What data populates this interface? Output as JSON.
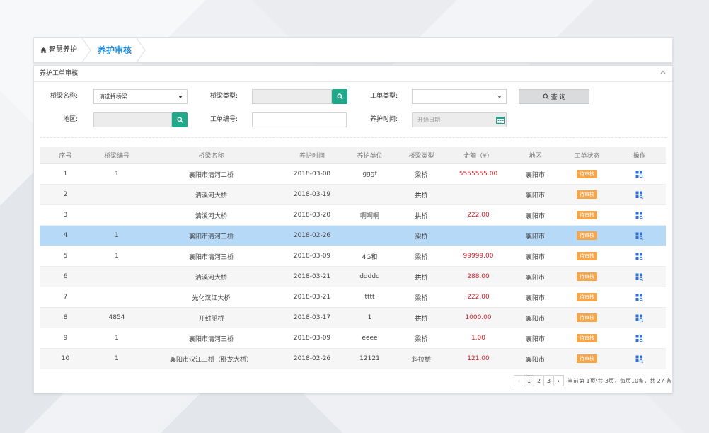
{
  "breadcrumb": {
    "home": "智慧养护",
    "current": "养护审核"
  },
  "panel": {
    "title": "养护工单审核"
  },
  "filters": {
    "bridge_name_label": "桥梁名称:",
    "bridge_name_value": "请选择桥梁",
    "bridge_type_label": "桥梁类型:",
    "order_type_label": "工单类型:",
    "query_label": "查 询",
    "region_label": "地区:",
    "order_no_label": "工单编号:",
    "maint_time_label": "养护时间:",
    "start_date_placeholder": "开始日期"
  },
  "table": {
    "headers": [
      "序号",
      "桥梁编号",
      "桥梁名称",
      "养护时间",
      "养护单位",
      "桥梁类型",
      "金额（¥）",
      "地区",
      "工单状态",
      "操作"
    ],
    "rows": [
      {
        "no": "1",
        "code": "1",
        "name": "襄阳市清河二桥",
        "time": "2018-03-08",
        "unit": "gggf",
        "type": "梁桥",
        "amount": "5555555.00",
        "region": "襄阳市",
        "status": "待审核"
      },
      {
        "no": "2",
        "code": "",
        "name": "清溪河大桥",
        "time": "2018-03-19",
        "unit": "",
        "type": "拱桥",
        "amount": "",
        "region": "襄阳市",
        "status": "待审核"
      },
      {
        "no": "3",
        "code": "",
        "name": "清溪河大桥",
        "time": "2018-03-20",
        "unit": "啊啊啊",
        "type": "拱桥",
        "amount": "222.00",
        "region": "襄阳市",
        "status": "待审核"
      },
      {
        "no": "4",
        "code": "1",
        "name": "襄阳市清河三桥",
        "time": "2018-02-26",
        "unit": "",
        "type": "梁桥",
        "amount": "",
        "region": "襄阳市",
        "status": "待审核"
      },
      {
        "no": "5",
        "code": "1",
        "name": "襄阳市清河三桥",
        "time": "2018-03-09",
        "unit": "4G和",
        "type": "梁桥",
        "amount": "99999.00",
        "region": "襄阳市",
        "status": "待审核"
      },
      {
        "no": "6",
        "code": "",
        "name": "清溪河大桥",
        "time": "2018-03-21",
        "unit": "ddddd",
        "type": "拱桥",
        "amount": "288.00",
        "region": "襄阳市",
        "status": "待审核"
      },
      {
        "no": "7",
        "code": "",
        "name": "光化汉江大桥",
        "time": "2018-03-21",
        "unit": "tttt",
        "type": "梁桥",
        "amount": "222.00",
        "region": "襄阳市",
        "status": "待审核"
      },
      {
        "no": "8",
        "code": "4854",
        "name": "开封船桥",
        "time": "2018-03-17",
        "unit": "1",
        "type": "拱桥",
        "amount": "1000.00",
        "region": "襄阳市",
        "status": "待审核"
      },
      {
        "no": "9",
        "code": "1",
        "name": "襄阳市清河三桥",
        "time": "2018-03-09",
        "unit": "eeee",
        "type": "梁桥",
        "amount": "1.00",
        "region": "襄阳市",
        "status": "待审核"
      },
      {
        "no": "10",
        "code": "1",
        "name": "襄阳市汉江三桥（卧龙大桥）",
        "time": "2018-02-26",
        "unit": "12121",
        "type": "斜拉桥",
        "amount": "121.00",
        "region": "襄阳市",
        "status": "待审核"
      }
    ]
  },
  "pagination": {
    "prev": "‹",
    "pages": [
      "1",
      "2",
      "3"
    ],
    "next": "›",
    "info": "当前第 1页/共 3页，每页10条，共 27 条"
  },
  "colors": {
    "accent": "#1e88d2",
    "green": "#1fa88a",
    "badge": "#f5a54a",
    "amount": "#d0202a",
    "selected": "#b7d9f8"
  }
}
